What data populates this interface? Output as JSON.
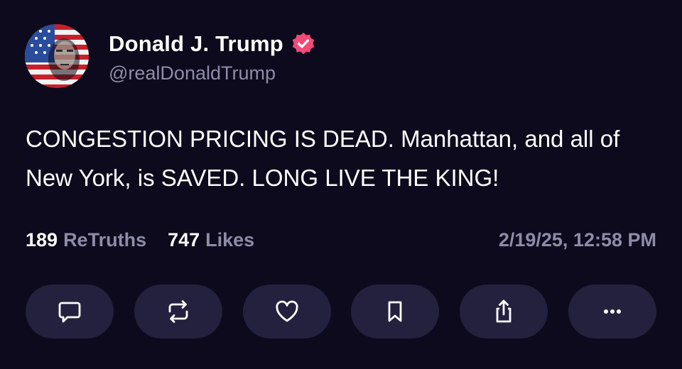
{
  "post": {
    "author": {
      "display_name": "Donald J. Trump",
      "handle": "@realDonaldTrump",
      "verified": true,
      "avatar_icon": "flag-portrait-avatar"
    },
    "text": "CONGESTION PRICING IS DEAD. Manhattan, and all of New York, is SAVED. LONG LIVE THE KING!",
    "stats": {
      "retruths_count": "189",
      "retruths_label": "ReTruths",
      "likes_count": "747",
      "likes_label": "Likes"
    },
    "timestamp": "2/19/25, 12:58 PM"
  },
  "actions": [
    {
      "name": "reply",
      "icon": "comment-icon"
    },
    {
      "name": "retruth",
      "icon": "repost-icon"
    },
    {
      "name": "like",
      "icon": "heart-icon"
    },
    {
      "name": "bookmark",
      "icon": "bookmark-icon"
    },
    {
      "name": "share",
      "icon": "share-icon"
    },
    {
      "name": "more",
      "icon": "more-icon"
    }
  ],
  "colors": {
    "background": "#0c0a1c",
    "button_bg": "#24213f",
    "secondary_text": "#8e8ca8",
    "verified_badge": "#f24a76"
  }
}
